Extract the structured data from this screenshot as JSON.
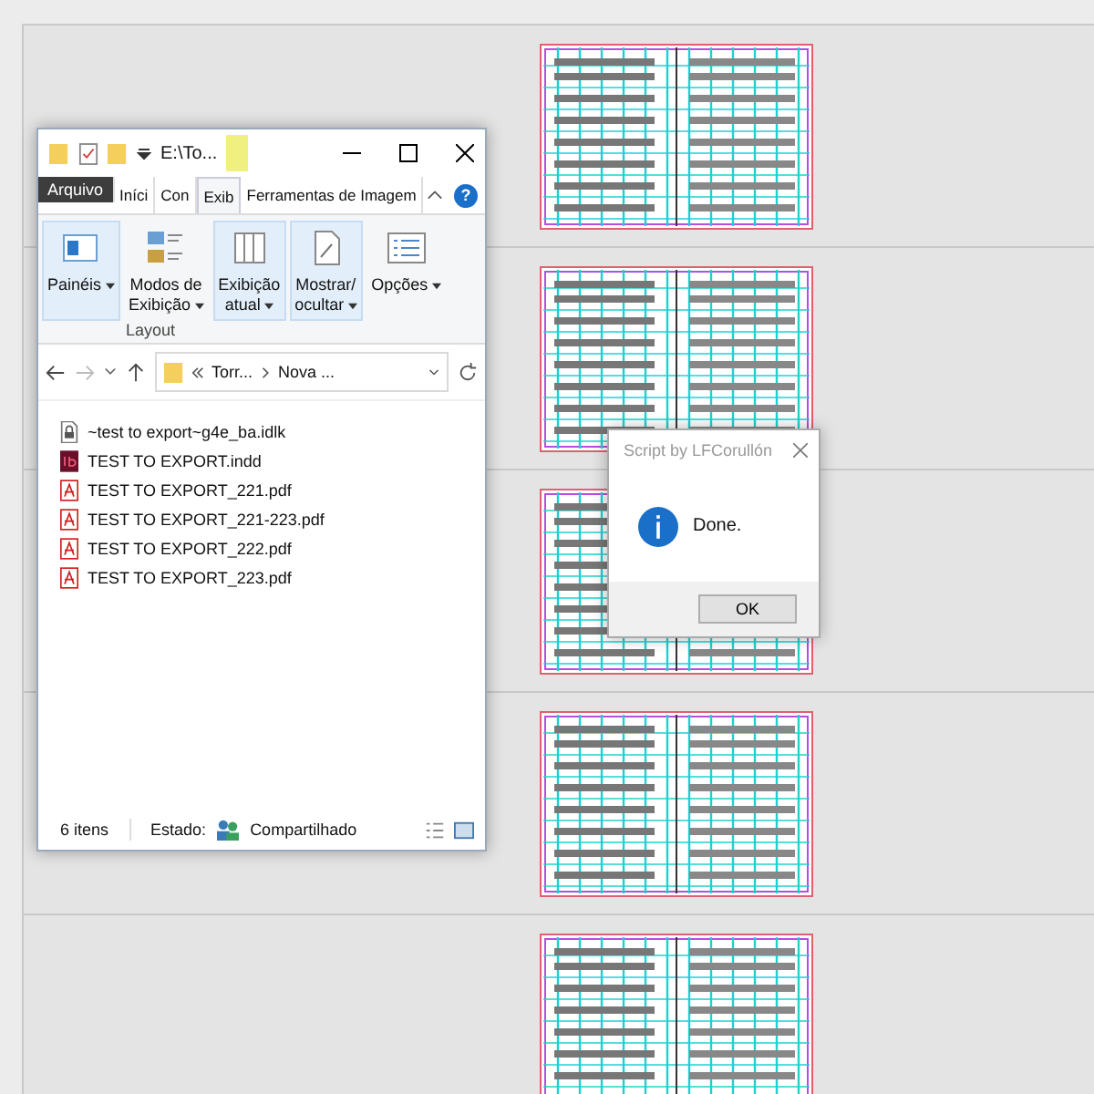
{
  "pages": [
    {
      "kind": "spread"
    },
    {
      "kind": "spread"
    },
    {
      "kind": "spread"
    },
    {
      "kind": "spread"
    },
    {
      "kind": "spread"
    }
  ],
  "explorer": {
    "title": "E:\\To...",
    "tabs": [
      {
        "label": "Arquivo",
        "kind": "file",
        "selected": false
      },
      {
        "label": "Iníci",
        "kind": "tab",
        "selected": false
      },
      {
        "label": "Con",
        "kind": "tab",
        "selected": false
      },
      {
        "label": "Exib",
        "kind": "tab",
        "selected": true
      },
      {
        "label": "Ferramentas de Imagem",
        "kind": "tab",
        "selected": false
      }
    ],
    "ribbon": {
      "buttons": [
        {
          "lines": [
            "Painéis"
          ],
          "kind": "panes",
          "selected": true
        },
        {
          "lines": [
            "Modos de",
            "Exibição"
          ],
          "kind": "layouts",
          "selected": false
        },
        {
          "lines": [
            "Exibição",
            "atual"
          ],
          "kind": "current",
          "selected": true
        },
        {
          "lines": [
            "Mostrar/",
            "ocultar"
          ],
          "kind": "show",
          "selected": true
        },
        {
          "lines": [
            "Opções"
          ],
          "kind": "options",
          "selected": false
        }
      ],
      "group_label": "Layout"
    },
    "help": "?",
    "breadcrumb": [
      "Torr...",
      "Nova ..."
    ],
    "files": [
      {
        "name": "~test to export~g4e_ba.idlk",
        "kind": "lock"
      },
      {
        "name": "TEST TO EXPORT.indd",
        "kind": "indd"
      },
      {
        "name": "TEST TO EXPORT_221.pdf",
        "kind": "pdf"
      },
      {
        "name": "TEST TO EXPORT_221-223.pdf",
        "kind": "pdf"
      },
      {
        "name": "TEST TO EXPORT_222.pdf",
        "kind": "pdf"
      },
      {
        "name": "TEST TO EXPORT_223.pdf",
        "kind": "pdf"
      }
    ],
    "status_bar": {
      "count": "6 itens",
      "state_label": "Estado:",
      "state": "Compartilhado"
    }
  },
  "dialog": {
    "title": "Script by LFCorullón",
    "message": "Done.",
    "button": "OK"
  }
}
